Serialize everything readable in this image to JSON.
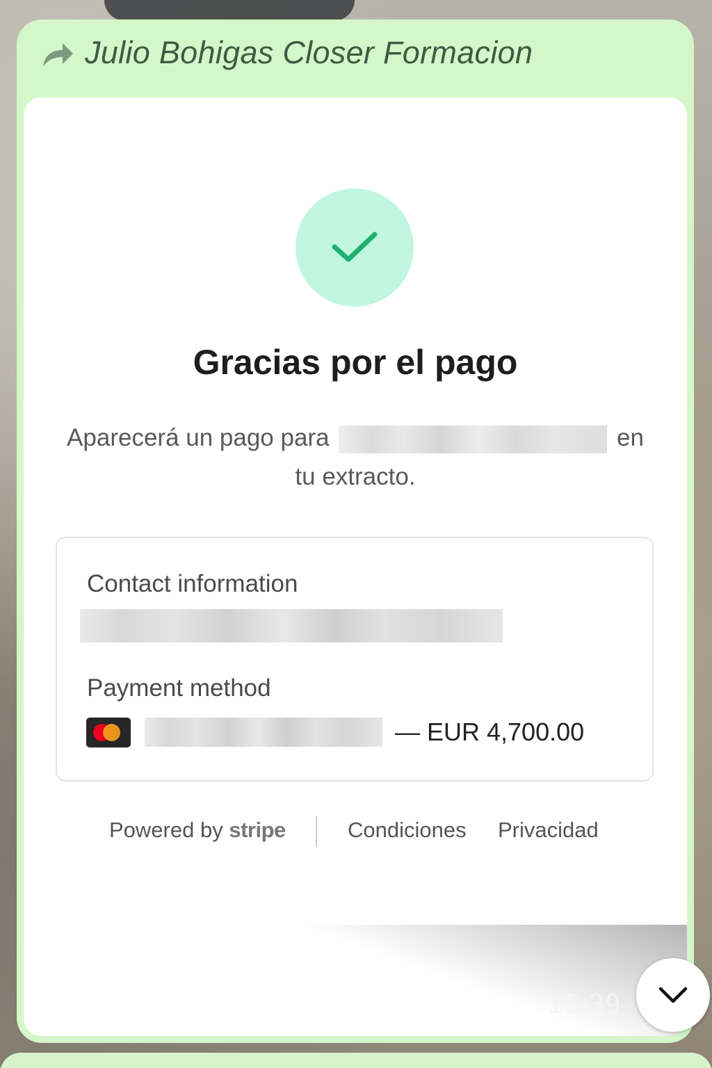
{
  "message": {
    "sender": "Julio Bohigas Closer Formacion",
    "time": "15:39"
  },
  "receipt": {
    "title": "Gracias por el pago",
    "statement_prefix": "Aparecerá un pago para",
    "statement_suffix": "en tu extracto.",
    "contact_label": "Contact information",
    "payment_label": "Payment method",
    "card_brand_icon": "mastercard-icon",
    "amount": "— EUR 4,700.00"
  },
  "footer": {
    "powered_by": "Powered by",
    "stripe": "stripe",
    "terms": "Condiciones",
    "privacy": "Privacidad"
  },
  "colors": {
    "bubble": "#d3f7c9",
    "check_bg": "#c1f6e1",
    "check": "#1fb070"
  }
}
